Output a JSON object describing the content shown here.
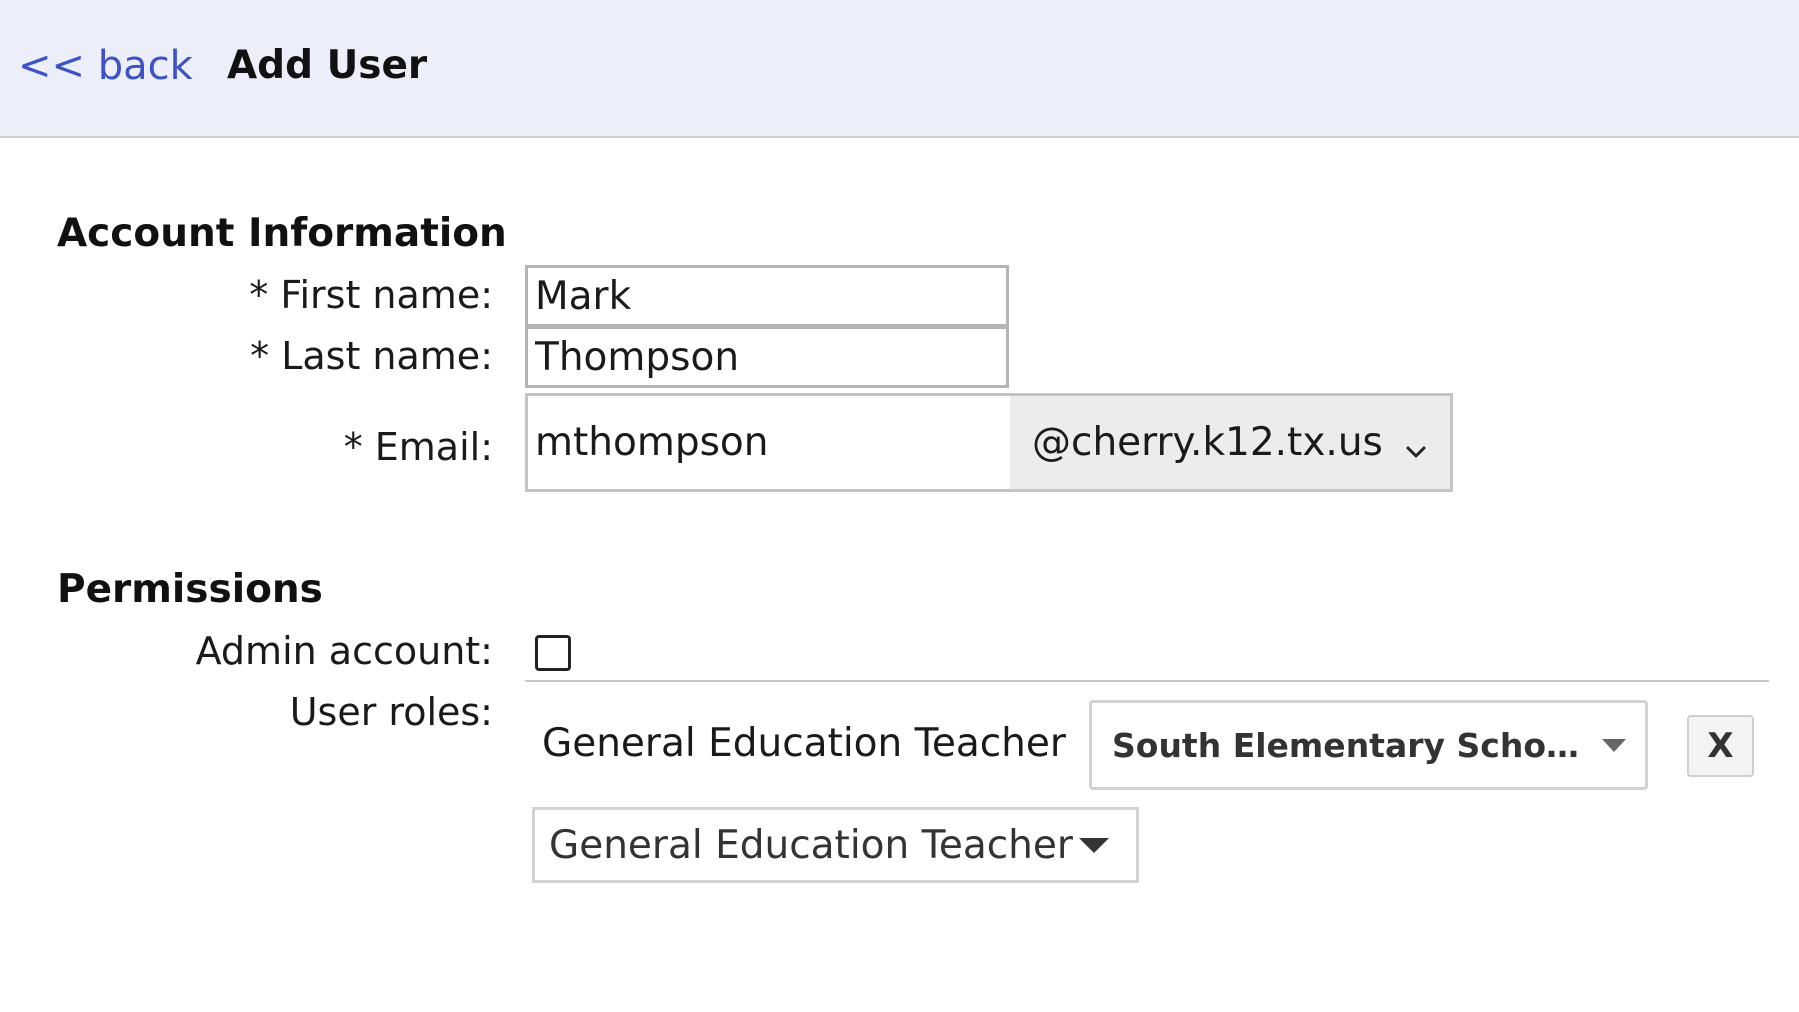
{
  "header": {
    "back_label": "<< back",
    "title": "Add User"
  },
  "account": {
    "section_title": "Account Information",
    "first_name_label": "* First name:",
    "first_name_value": "Mark",
    "last_name_label": "* Last name:",
    "last_name_value": "Thompson",
    "email_label": "* Email:",
    "email_value": "mthompson",
    "email_domain": "@cherry.k12.tx.us"
  },
  "permissions": {
    "section_title": "Permissions",
    "admin_label": "Admin account:",
    "admin_checked": false,
    "roles_label": "User roles:",
    "roles": [
      {
        "name": "General Education Teacher",
        "school": "South Elementary School (...",
        "remove_label": "X"
      }
    ],
    "add_role_select": "General Education Teacher"
  },
  "colors": {
    "header_bg": "#eceef9",
    "link": "#3d52c7",
    "domain_bg": "#ececec"
  },
  "icons": {
    "domain_dropdown": "chevron-down-icon",
    "school_dropdown": "caret-down-icon",
    "role_dropdown": "caret-down-icon"
  }
}
